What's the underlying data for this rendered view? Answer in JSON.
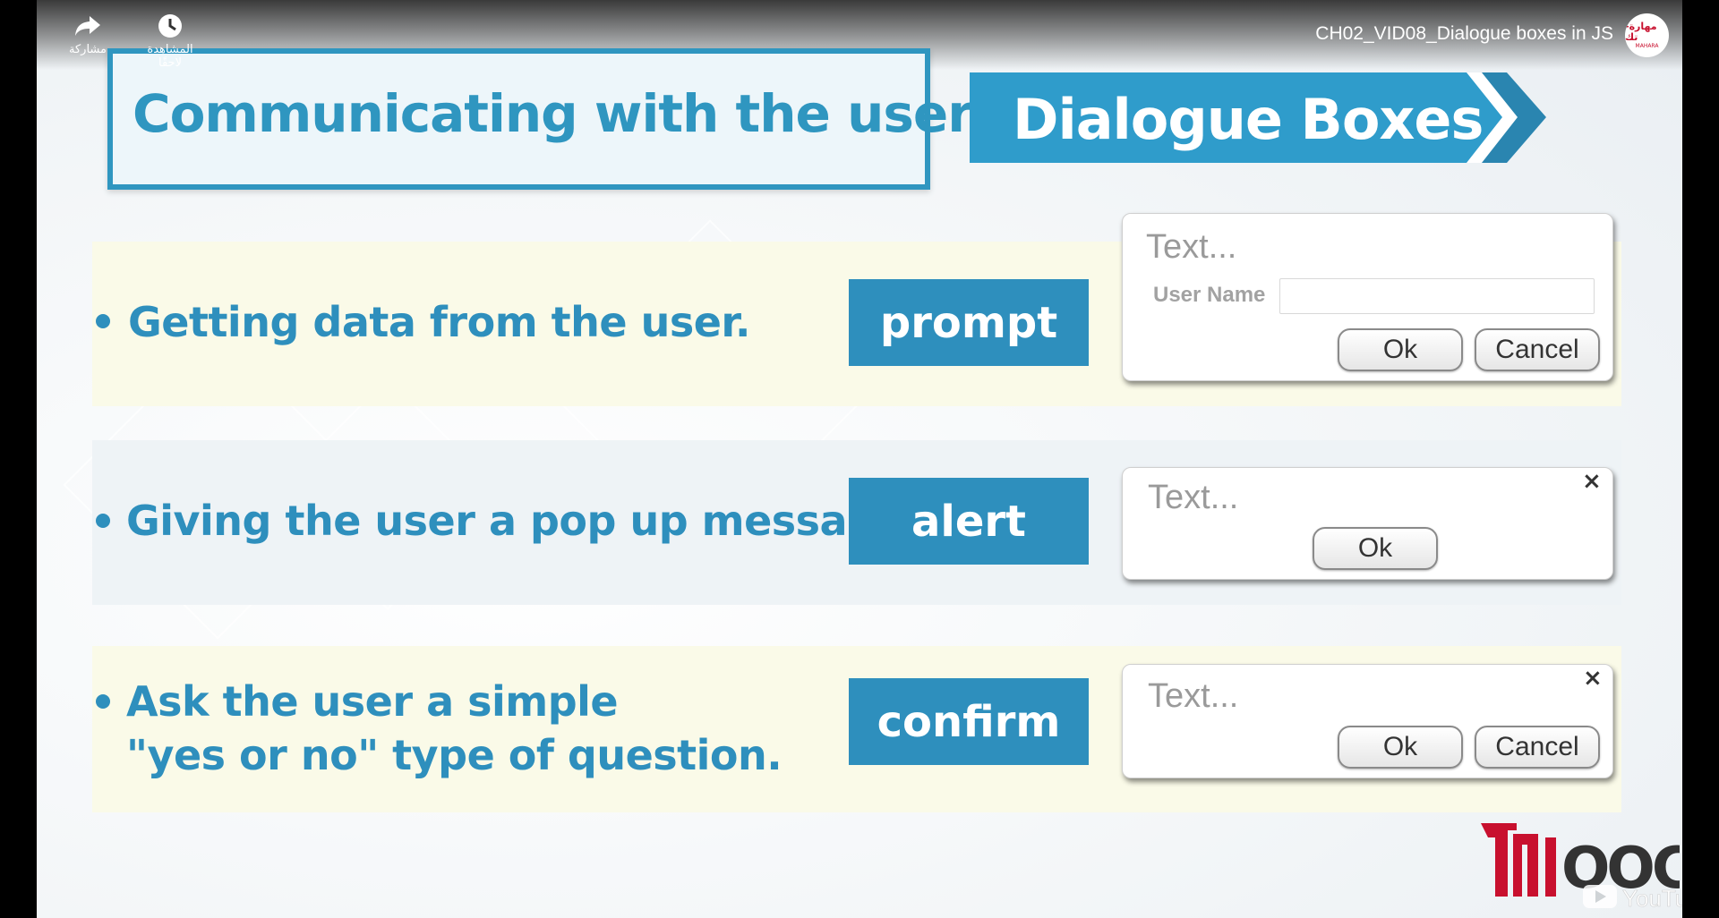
{
  "video": {
    "title": "CH02_VID08_Dialogue boxes in JS",
    "share_label": "مشاركة",
    "watch_later_label": "المشاهدة لاحقًا",
    "channel_avatar_text": "مهارة-تك",
    "channel_avatar_subtext": "MAHARA"
  },
  "slide": {
    "title": "Communicating with the user",
    "banner": "Dialogue Boxes",
    "rows": [
      {
        "bullet_lines": [
          "Getting data from the user."
        ],
        "tag": "prompt",
        "dialog": {
          "text": "Text...",
          "field_label": "User Name",
          "field_value": "",
          "ok": "Ok",
          "cancel": "Cancel",
          "has_close": false
        }
      },
      {
        "bullet_lines": [
          "Giving the user a pop up message."
        ],
        "tag": "alert",
        "dialog": {
          "text": "Text...",
          "ok": "Ok",
          "close": "×",
          "has_close": true
        }
      },
      {
        "bullet_lines": [
          "Ask the user a simple",
          "\"yes or no\" type of question."
        ],
        "tag": "confirm",
        "dialog": {
          "text": "Text...",
          "ok": "Ok",
          "cancel": "Cancel",
          "close": "×",
          "has_close": true
        }
      }
    ],
    "logo_text": "MOOC.A",
    "watermark_text": "YouTube"
  },
  "colors": {
    "accent_blue": "#2e8fbd",
    "row_yellow": "#fafae8",
    "row_blue": "#eef3f6",
    "logo_red": "#c8102e"
  }
}
